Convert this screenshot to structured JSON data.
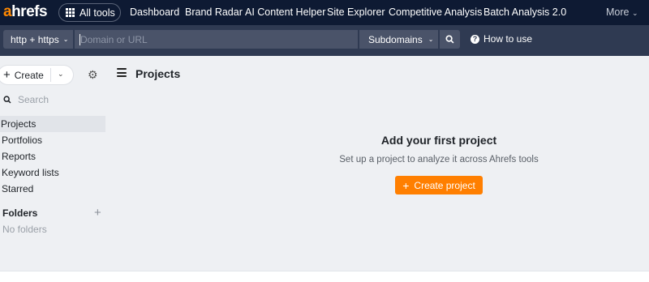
{
  "topnav": {
    "logo_a": "a",
    "logo_rest": "hrefs",
    "all_tools": "All tools",
    "links": [
      "Dashboard",
      "Brand Radar",
      "AI Content Helper",
      "Site Explorer",
      "Competitive Analysis",
      "Batch Analysis 2.0"
    ],
    "more": "More",
    "colors": {
      "bg": "#0e1a33",
      "brand": "#ff8800"
    }
  },
  "searchbar": {
    "protocol": "http + https",
    "placeholder": "Domain or URL",
    "mode": "Subdomains",
    "how_to_use": "How to use"
  },
  "sidebar": {
    "create_label": "Create",
    "search_placeholder": "Search",
    "items": [
      "Projects",
      "Portfolios",
      "Reports",
      "Keyword lists",
      "Starred"
    ],
    "folders_heading": "Folders",
    "no_folders": "No folders"
  },
  "main": {
    "title": "Projects",
    "empty_title": "Add your first project",
    "empty_subtitle": "Set up a project to analyze it across Ahrefs tools",
    "create_project": "Create project"
  }
}
